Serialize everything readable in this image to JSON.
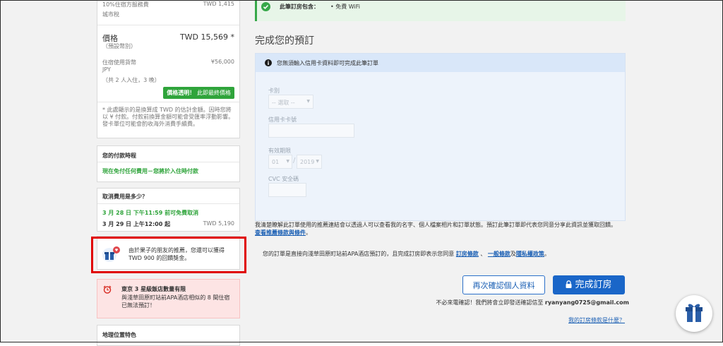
{
  "summary": {
    "service_fee_label": "10%住宿方服務費",
    "service_fee_value": "TWD 1,415",
    "city_tax_label": "城市稅",
    "price_label": "價格",
    "price_value": "TWD 15,569 *",
    "price_note": "（預設幣別）",
    "local_currency_label": "住宿使用貨幣",
    "local_currency_code": "JPY",
    "local_currency_value": "¥56,000",
    "guests_nights": "（共 2 人入住，3 晚）",
    "transparent_badge_bold": "價格透明！",
    "transparent_badge_rest": "此即最終價格",
    "disclaimer": "* 此處顯示的是換算成 TWD 的估計金額。因時您將以 ¥ 付款。付款前換算金額可能會受匯率浮動影響。發卡單位可能會酌收海外消費手續費。"
  },
  "payment_timing": {
    "title": "您的付款時程",
    "text": "現在免付任何費用－您將於入住時付款"
  },
  "cancellation": {
    "title": "取消費用是多少？",
    "line1": "3 月 28 日 下午11:59 前可免費取消",
    "line2_left": "3 月 29 日 上午12:00 起",
    "line2_right": "TWD 5,190"
  },
  "reward": {
    "text": "由於果子的朋友的推薦，您還可以獲得 TWD 900 的回饋獎金。"
  },
  "alert": {
    "bold": "東京 3 星級飯店數量有限",
    "text": "與淺草田原町站前APA酒店相似的 8 間住宿已無法預訂！"
  },
  "location": {
    "title": "地理位置特色"
  },
  "includes": {
    "label": "此筆訂房包含：",
    "item": "• 免費 WiFi"
  },
  "form": {
    "title": "完成您的預訂",
    "info": "您無須輸入信用卡資料即可完成此筆訂單",
    "card_type_label": "卡別",
    "card_type_value": "-- 選取 --",
    "card_number_label": "信用卡卡號",
    "expiry_label": "有效期限",
    "expiry_month": "01",
    "expiry_year": "2019",
    "cvc_label": "CVC 安全碼"
  },
  "consent": {
    "text": "我清楚瞭解此訂單使用的推薦連結會以透過人可以查看我的名字、個人檔案相片和訂單狀態。預訂此筆訂單即代表您同意分享此資訊並獲取回饋。",
    "link": "查看推薦條款與條件",
    "end": "。"
  },
  "terms": {
    "prefix": "您的訂單是直接向淺草田原町站前APA酒店預訂的，且完成訂房即表示您同意",
    "link1": "訂房條款",
    "sep1": "、",
    "link2": "一般條款",
    "sep2": "及",
    "link3": "隱私權政策",
    "end": "。"
  },
  "buttons": {
    "recheck": "再次確認個人資料",
    "complete": "完成訂房"
  },
  "confirmation": {
    "text": "不必來電確認！我們將會立即發送確認信至",
    "email": "ryanyang0725@gmail.com"
  },
  "footer_link": "我的訂房條款是什麼？",
  "colors": {
    "brand_blue": "#1a66c8",
    "green": "#2fa43b",
    "red_highlight": "#e00000"
  }
}
